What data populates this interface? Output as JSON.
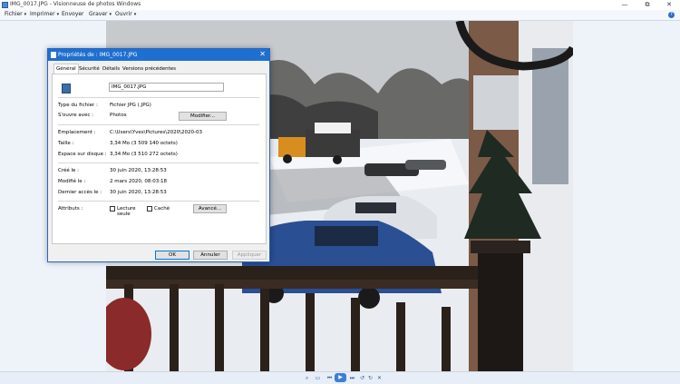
{
  "window": {
    "title": "IMG_0017.JPG - Visionneuse de photos Windows",
    "controls": [
      "—",
      "⧉",
      "✕"
    ]
  },
  "menu": {
    "items": [
      {
        "label": "Fichier"
      },
      {
        "label": "Imprimer"
      },
      {
        "label": "Envoyer"
      },
      {
        "label": "Graver"
      },
      {
        "label": "Ouvrir"
      }
    ],
    "help": "?"
  },
  "dialog": {
    "title": "Propriétés de : IMG_0017.JPG",
    "close": "✕",
    "tabs": [
      "Général",
      "Sécurité",
      "Détails",
      "Versions précédentes"
    ],
    "file_name": "IMG_0017.JPG",
    "rows": {
      "type": {
        "label": "Type du fichier :",
        "value": "Fichier JPG (.JPG)"
      },
      "opens_with": {
        "label": "S'ouvre avec :",
        "value": "Photos",
        "button": "Modifier..."
      },
      "location": {
        "label": "Emplacement :",
        "value": "C:\\Users\\Yves\\Pictures\\2020\\2020-03"
      },
      "size": {
        "label": "Taille :",
        "value": "3,34 Mo (3 509 140 octets)"
      },
      "size_on_disk": {
        "label": "Espace sur disque :",
        "value": "3,34 Mo (3 510 272 octets)"
      },
      "created": {
        "label": "Créé le :",
        "value": "30 juin 2020, 13:28:53"
      },
      "modified": {
        "label": "Modifié le :",
        "value": "2 mars 2020, 08:03:18"
      },
      "accessed": {
        "label": "Dernier accès le :",
        "value": "30 juin 2020, 13:28:53"
      },
      "attributes": {
        "label": "Attributs :",
        "readonly": "Lecture seule",
        "hidden": "Caché",
        "button": "Avancé..."
      }
    },
    "buttons": {
      "ok": "OK",
      "cancel": "Annuler",
      "apply": "Appliquer"
    }
  },
  "toolbar": {
    "icons": [
      "zoom-icon",
      "fit-icon",
      "previous-icon",
      "slideshow-icon",
      "next-icon",
      "rotate-left-icon",
      "rotate-right-icon",
      "delete-icon"
    ],
    "glyphs": {
      "zoom": "⌕",
      "fit": "▭",
      "prev": "⏮",
      "play": "▶",
      "next": "⏭",
      "rotl": "↺",
      "rotr": "↻",
      "del": "✕"
    }
  }
}
